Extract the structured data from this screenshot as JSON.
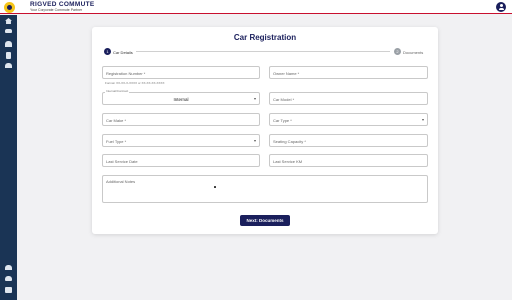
{
  "header": {
    "brand": "RIGVED COMMUTE",
    "tagline": "Your Corporate Commute Partner"
  },
  "sidebar": {
    "top_items": [
      "home-icon",
      "car-icon",
      "users-icon",
      "document-icon",
      "group-icon"
    ],
    "bottom_items": [
      "add-user-icon",
      "car-icon",
      "settings-icon"
    ]
  },
  "form": {
    "title": "Car Registration",
    "steps": [
      {
        "number": "1",
        "label": "Car Details"
      },
      {
        "number": "2",
        "label": "Documents"
      }
    ],
    "registration_number": {
      "placeholder": "Registration Number *",
      "hint": "Format: XX-XX-X-XXXX or XX-XX-XX-XXXX"
    },
    "owner_name": {
      "placeholder": "Owner Name *"
    },
    "internal_contract": {
      "label": "Internal/Contract",
      "value": "Internal"
    },
    "car_model": {
      "placeholder": "Car Model *"
    },
    "car_make": {
      "placeholder": "Car Make *"
    },
    "car_type": {
      "placeholder": "Car Type *"
    },
    "fuel_type": {
      "placeholder": "Fuel Type *"
    },
    "seating_capacity": {
      "placeholder": "Seating Capacity *"
    },
    "last_service_date": {
      "placeholder": "Last Service Date"
    },
    "last_service_km": {
      "placeholder": "Last Service KM"
    },
    "additional_notes": {
      "placeholder": "Additional Notes"
    },
    "next_button": "Next: Documents"
  },
  "colors": {
    "primary": "#1a1f5c",
    "sidebar": "#1a3455",
    "accent": "#c8102e",
    "logo": "#f5c518"
  }
}
